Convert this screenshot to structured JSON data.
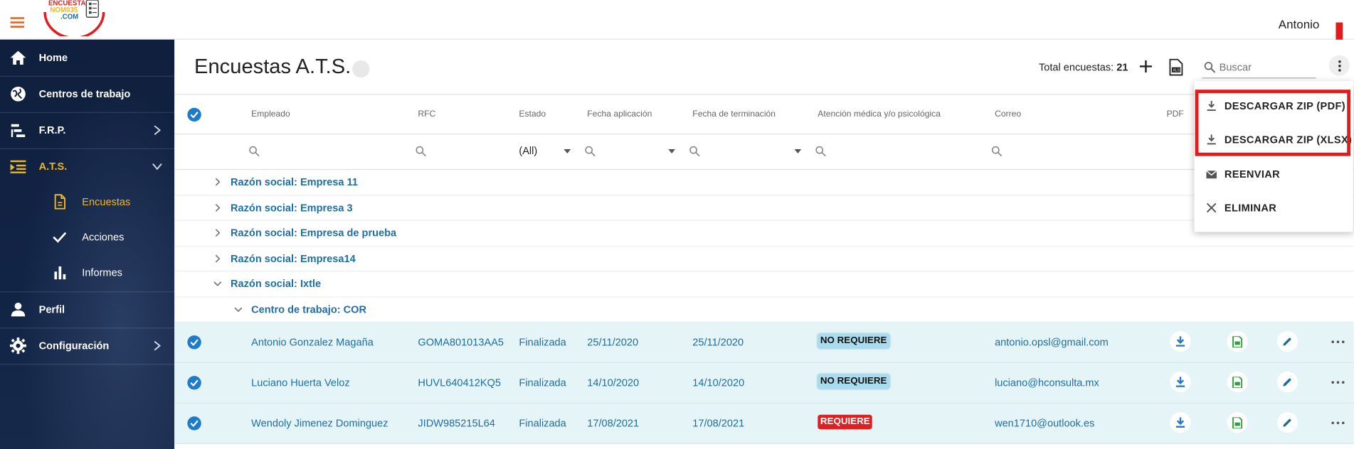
{
  "topbar": {
    "logo_text": [
      "ENCUESTA",
      "NOM035",
      ".COM"
    ],
    "user_name": "Antonio"
  },
  "sidebar": {
    "items": [
      {
        "label": "Home",
        "icon": "home-icon"
      },
      {
        "label": "Centros de trabajo",
        "icon": "globe-icon"
      },
      {
        "label": "F.R.P.",
        "icon": "list-steps-icon"
      },
      {
        "label": "A.T.S.",
        "icon": "list-indent-icon",
        "active": true
      },
      {
        "label": "Perfil",
        "icon": "person-icon"
      },
      {
        "label": "Configuración",
        "icon": "gear-icon"
      }
    ],
    "sub_items": [
      {
        "label": "Encuestas",
        "icon": "document-icon",
        "active": true
      },
      {
        "label": "Acciones",
        "icon": "check-icon"
      },
      {
        "label": "Informes",
        "icon": "bar-chart-icon"
      }
    ]
  },
  "header": {
    "title": "Encuestas A.T.S.",
    "total_label": "Total encuestas:",
    "total_value": "21",
    "search_placeholder": "Buscar"
  },
  "table": {
    "columns": [
      "Empleado",
      "RFC",
      "Estado",
      "Fecha aplicación",
      "Fecha de terminación",
      "Atención médica y/o psicológica",
      "Correo",
      "PDF"
    ],
    "estado_filter": "(All)",
    "groups": [
      "Razón social: Empresa 11",
      "Razón social: Empresa 3",
      "Razón social: Empresa de prueba",
      "Razón social: Empresa14",
      "Razón social: Ixtle"
    ],
    "subgroup": "Centro de trabajo: COR",
    "rows": [
      {
        "empleado": "Antonio Gonzalez Magaña",
        "rfc": "GOMA801013AA5",
        "estado": "Finalizada",
        "fecha_aplicacion": "25/11/2020",
        "fecha_terminacion": "25/11/2020",
        "atencion": "NO REQUIERE",
        "correo": "antonio.opsl@gmail.com"
      },
      {
        "empleado": "Luciano Huerta Veloz",
        "rfc": "HUVL640412KQ5",
        "estado": "Finalizada",
        "fecha_aplicacion": "14/10/2020",
        "fecha_terminacion": "14/10/2020",
        "atencion": "NO REQUIERE",
        "correo": "luciano@hconsulta.mx"
      },
      {
        "empleado": "Wendoly Jimenez Dominguez",
        "rfc": "JIDW985215L64",
        "estado": "Finalizada",
        "fecha_aplicacion": "17/08/2021",
        "fecha_terminacion": "17/08/2021",
        "atencion": "REQUIERE",
        "correo": "wen1710@outlook.es"
      }
    ]
  },
  "dropdown": {
    "items": [
      {
        "label": "DESCARGAR ZIP (PDF)",
        "icon": "download-icon"
      },
      {
        "label": "DESCARGAR ZIP (XLSX)",
        "icon": "download-icon"
      },
      {
        "label": "REENVIAR",
        "icon": "mail-icon"
      },
      {
        "label": "ELIMINAR",
        "icon": "close-icon"
      }
    ]
  },
  "colors": {
    "sidebar_bg": "#0f1f3d",
    "accent": "#f2b61d",
    "link_blue": "#1d6fa6",
    "row_highlight": "#e5f4f6",
    "badge_requiere": "#e02020",
    "badge_no_requiere": "#a9dcef",
    "annotation_red": "#e21b1b"
  }
}
